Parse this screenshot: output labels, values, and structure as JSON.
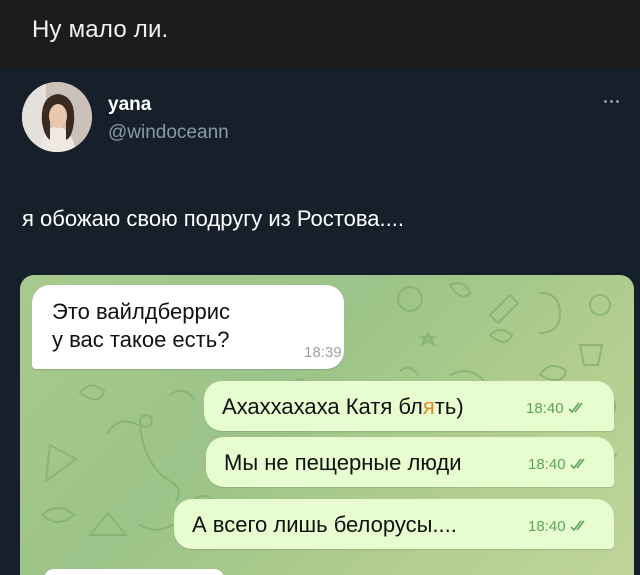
{
  "caption": "Ну мало ли.",
  "tweet": {
    "author_name": "yana",
    "author_handle": "@windoceann",
    "text": "я обожаю свою подругу из Ростова...."
  },
  "chat": {
    "incoming": {
      "line1": "Это вайлдберрис",
      "line2": "у вас такое есть?",
      "time": "18:39"
    },
    "outgoing": [
      {
        "text": "Ахаххахаха Катя бл░ть)",
        "time": "18:40"
      },
      {
        "text": "Мы не пещерные люди",
        "time": "18:40"
      },
      {
        "text": "А всего лишь белорусы....",
        "time": "18:40"
      }
    ]
  },
  "colors": {
    "page_bg": "#15202b",
    "caption_bg": "#1c1c1c",
    "handle": "#8b98a5",
    "incoming_bubble": "#ffffff",
    "outgoing_bubble": "#e7fdd0",
    "outgoing_time": "#5da35c",
    "chat_bg": "#a9c98f",
    "censor_mark": "#e08a2a"
  },
  "icons": {
    "more": "more-horizontal-icon",
    "read_receipt": "double-check-icon"
  }
}
